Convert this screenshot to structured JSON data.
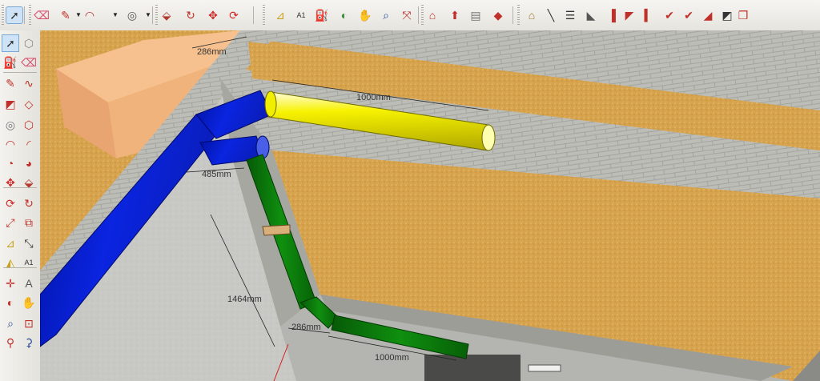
{
  "toolbar_top": {
    "items": [
      {
        "name": "select-tool",
        "icon": "arrow-cursor-icon",
        "glyph": "➚",
        "active": true
      },
      {
        "name": "eraser-tool",
        "icon": "eraser-icon",
        "glyph": "⌫",
        "color": "#d84a6a"
      },
      {
        "name": "line-tool",
        "icon": "pencil-icon",
        "glyph": "✎",
        "color": "#c0302a"
      },
      {
        "name": "arc-tool",
        "icon": "arc-icon",
        "glyph": "◠",
        "color": "#b03030"
      },
      {
        "name": "circle-tool",
        "icon": "circle-icon",
        "glyph": "◎",
        "color": "#555555"
      },
      {
        "name": "push-pull-tool",
        "icon": "push-pull-icon",
        "glyph": "⬙",
        "color": "#b33b2e"
      },
      {
        "name": "follow-me-tool",
        "icon": "follow-me-icon",
        "glyph": "↻",
        "color": "#c0302a"
      },
      {
        "name": "move-tool",
        "icon": "move-icon",
        "glyph": "✥",
        "color": "#d02a2a"
      },
      {
        "name": "rotate-tool",
        "icon": "rotate-icon",
        "glyph": "⟳",
        "color": "#d02a2a"
      },
      {
        "name": "tape-measure-tool",
        "icon": "tape-measure-icon",
        "glyph": "⊿",
        "color": "#c9a21b"
      },
      {
        "name": "text-tool",
        "icon": "text-icon",
        "glyph": "A1"
      },
      {
        "name": "paint-bucket-tool",
        "icon": "paint-bucket-icon",
        "glyph": "⛽",
        "color": "#6b5a2a"
      },
      {
        "name": "orbit-tool",
        "icon": "orbit-icon",
        "glyph": "◐",
        "color": "#3a8a3a"
      },
      {
        "name": "pan-tool",
        "icon": "hand-icon",
        "glyph": "✋",
        "color": "#d8b07a"
      },
      {
        "name": "zoom-tool",
        "icon": "magnifier-icon",
        "glyph": "⌕",
        "color": "#2a4f9a"
      },
      {
        "name": "zoom-extents-tool",
        "icon": "zoom-extents-icon",
        "glyph": "⤧",
        "color": "#c0302a"
      },
      {
        "name": "warehouse-button",
        "icon": "warehouse-icon",
        "glyph": "⌂",
        "color": "#c0302a"
      },
      {
        "name": "share-model-button",
        "icon": "share-model-icon",
        "glyph": "⬆",
        "color": "#c0302a"
      },
      {
        "name": "components-button",
        "icon": "components-icon",
        "glyph": "▤",
        "color": "#777777"
      },
      {
        "name": "extension-warehouse-button",
        "icon": "extension-icon",
        "glyph": "◆",
        "color": "#c0302a"
      },
      {
        "name": "iso-view-button",
        "icon": "iso-view-icon",
        "glyph": "⌂",
        "color": "#9a7a30"
      },
      {
        "name": "line-style-button",
        "icon": "diagonal-line-icon",
        "glyph": "╲"
      },
      {
        "name": "list-button",
        "icon": "list-icon",
        "glyph": "☰"
      },
      {
        "name": "fold-button",
        "icon": "fold-icon",
        "glyph": "◣",
        "color": "#555555"
      },
      {
        "name": "red-wall-button",
        "icon": "wall-icon",
        "glyph": "▐",
        "color": "#c0302a"
      },
      {
        "name": "angled-wall-button",
        "icon": "angled-wall-icon",
        "glyph": "◤",
        "color": "#c0302a"
      },
      {
        "name": "double-wall-button",
        "icon": "double-wall-icon",
        "glyph": "▍",
        "color": "#c0302a"
      },
      {
        "name": "check-button",
        "icon": "checkmark-icon",
        "glyph": "✔",
        "color": "#c0302a"
      },
      {
        "name": "check-alt-button",
        "icon": "checkmark-alt-icon",
        "glyph": "✔",
        "color": "#c0302a"
      },
      {
        "name": "slope-button",
        "icon": "slope-icon",
        "glyph": "◢",
        "color": "#c0302a"
      },
      {
        "name": "dark-wall-button",
        "icon": "dark-wall-icon",
        "glyph": "◩",
        "color": "#333333"
      },
      {
        "name": "window-button",
        "icon": "window-icon",
        "glyph": "❐",
        "color": "#c0302a"
      }
    ]
  },
  "toolbar_left": {
    "items": [
      {
        "name": "select-tool",
        "icon": "arrow-cursor-icon",
        "glyph": "➚",
        "active": true
      },
      {
        "name": "component-tool",
        "icon": "component-icon",
        "glyph": "⬡",
        "color": "#888888"
      },
      {
        "name": "paint-bucket-tool",
        "icon": "paint-bucket-icon",
        "glyph": "⛽",
        "color": "#7a5a22"
      },
      {
        "name": "eraser-tool",
        "icon": "eraser-icon",
        "glyph": "⌫",
        "color": "#d84a6a"
      },
      {
        "name": "line-tool",
        "icon": "pencil-icon",
        "glyph": "✎",
        "color": "#c0302a"
      },
      {
        "name": "freehand-tool",
        "icon": "freehand-icon",
        "glyph": "∿",
        "color": "#c0302a"
      },
      {
        "name": "rectangle-tool",
        "icon": "rectangle-icon",
        "glyph": "◩",
        "color": "#c0302a"
      },
      {
        "name": "rotated-rect-tool",
        "icon": "rotated-rectangle-icon",
        "glyph": "◇",
        "color": "#c0302a"
      },
      {
        "name": "circle-tool",
        "icon": "circle-icon",
        "glyph": "◎",
        "color": "#777777"
      },
      {
        "name": "polygon-tool",
        "icon": "polygon-icon",
        "glyph": "⬡",
        "color": "#c0302a"
      },
      {
        "name": "arc-tool",
        "icon": "arc-icon",
        "glyph": "◠",
        "color": "#c0302a"
      },
      {
        "name": "two-point-arc-tool",
        "icon": "two-point-arc-icon",
        "glyph": "◜",
        "color": "#c0302a"
      },
      {
        "name": "three-point-arc-tool",
        "icon": "three-point-arc-icon",
        "glyph": "◔",
        "color": "#c0302a"
      },
      {
        "name": "pie-tool",
        "icon": "pie-icon",
        "glyph": "◕",
        "color": "#c0302a"
      },
      {
        "name": "move-tool",
        "icon": "move-icon",
        "glyph": "✥",
        "color": "#d02a2a"
      },
      {
        "name": "push-pull-tool",
        "icon": "push-pull-icon",
        "glyph": "⬙",
        "color": "#b33b2e"
      },
      {
        "name": "rotate-tool",
        "icon": "rotate-icon",
        "glyph": "⟳",
        "color": "#d02a2a"
      },
      {
        "name": "follow-me-tool",
        "icon": "follow-me-icon",
        "glyph": "↻",
        "color": "#c0302a"
      },
      {
        "name": "scale-tool",
        "icon": "scale-icon",
        "glyph": "⤢",
        "color": "#c0302a"
      },
      {
        "name": "offset-tool",
        "icon": "offset-icon",
        "glyph": "⧉",
        "color": "#c0302a"
      },
      {
        "name": "tape-measure-tool",
        "icon": "tape-measure-icon",
        "glyph": "⊿",
        "color": "#c9a21b"
      },
      {
        "name": "dimension-tool",
        "icon": "dimension-icon",
        "glyph": "⤡"
      },
      {
        "name": "protractor-tool",
        "icon": "protractor-icon",
        "glyph": "◭",
        "color": "#c9a21b"
      },
      {
        "name": "text-tool",
        "icon": "text-icon",
        "glyph": "A1"
      },
      {
        "name": "axes-tool",
        "icon": "axes-icon",
        "glyph": "✛",
        "color": "#c0302a"
      },
      {
        "name": "3d-text-tool",
        "icon": "3d-text-icon",
        "glyph": "A",
        "color": "#555555"
      },
      {
        "name": "orbit-tool",
        "icon": "orbit-icon",
        "glyph": "◐",
        "color": "#c0302a"
      },
      {
        "name": "pan-tool",
        "icon": "hand-icon",
        "glyph": "✋",
        "color": "#d8b07a"
      },
      {
        "name": "zoom-tool",
        "icon": "magnifier-icon",
        "glyph": "⌕",
        "color": "#2a4f9a"
      },
      {
        "name": "zoom-window-tool",
        "icon": "zoom-window-icon",
        "glyph": "⊡",
        "color": "#c0302a"
      },
      {
        "name": "position-camera-tool",
        "icon": "camera-icon",
        "glyph": "⚲",
        "color": "#c0302a"
      },
      {
        "name": "walk-tool",
        "icon": "footprints-icon",
        "glyph": "⚳",
        "color": "#2a4f9a"
      }
    ]
  },
  "viewport": {
    "dimensions": {
      "top_width": "286mm",
      "yellow_length": "1000mm",
      "left_offset": "485mm",
      "vertical_length": "1464mm",
      "bottom_width": "286mm",
      "green_length": "1000mm"
    },
    "colors": {
      "blue_pipe": "#0a1fd4",
      "yellow_pipe": "#f7f200",
      "green_pipe": "#0b7a0b",
      "floor": "#d7a64f",
      "wall": "#a8a8a3",
      "ground": "#c9c9c6"
    }
  }
}
